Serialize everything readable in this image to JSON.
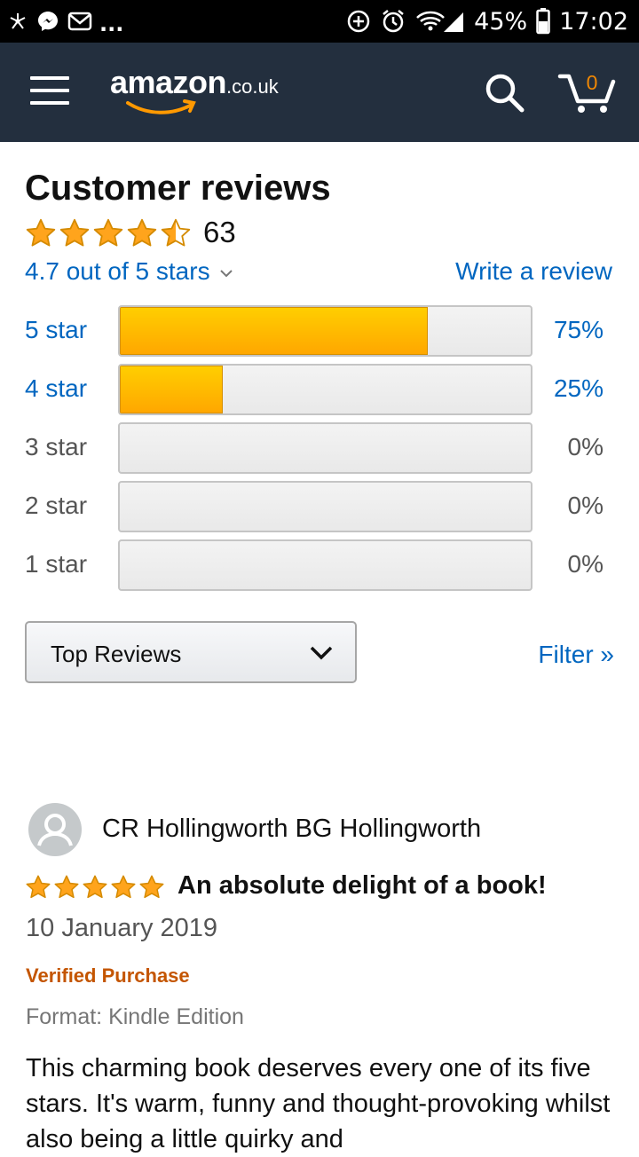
{
  "status_bar": {
    "left_icons": [
      "pinwheel-icon",
      "messenger-icon",
      "mail-icon"
    ],
    "overflow": "...",
    "battery": "45%",
    "time": "17:02"
  },
  "header": {
    "logo_main": "amazon",
    "logo_tld": ".co.uk",
    "cart_count": "0"
  },
  "reviews": {
    "title": "Customer reviews",
    "average_stars": 4.5,
    "count": "63",
    "rating_text": "4.7 out of 5 stars",
    "write_review": "Write a review",
    "histogram": [
      {
        "label": "5 star",
        "percent_text": "75%",
        "value": 0.75,
        "active": true
      },
      {
        "label": "4 star",
        "percent_text": "25%",
        "value": 0.25,
        "active": true
      },
      {
        "label": "3 star",
        "percent_text": "0%",
        "value": 0,
        "active": false
      },
      {
        "label": "2 star",
        "percent_text": "0%",
        "value": 0,
        "active": false
      },
      {
        "label": "1 star",
        "percent_text": "0%",
        "value": 0,
        "active": false
      }
    ],
    "sort_selected": "Top Reviews",
    "filter_label": "Filter »"
  },
  "review": {
    "author": "CR Hollingworth BG Hollingworth",
    "stars": 5,
    "title": "An absolute delight of a book!",
    "date": "10 January 2019",
    "verified": "Verified Purchase",
    "format": "Format: Kindle Edition",
    "body": "This charming book deserves every one of its five stars. It's warm, funny and thought-provoking whilst also being a little quirky and"
  },
  "colors": {
    "header_bg": "#232f3e",
    "link": "#0066c0",
    "star": "#ffa41c",
    "verified": "#c45500",
    "bar_fill": "#ffb800"
  }
}
